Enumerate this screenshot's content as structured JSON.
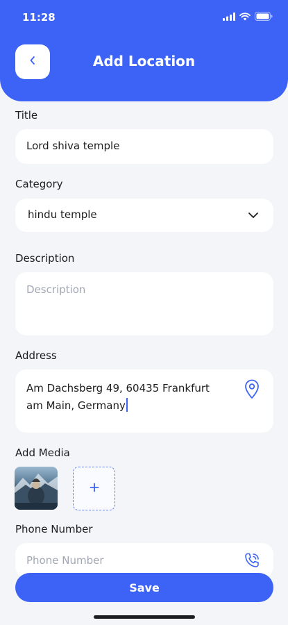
{
  "status_bar": {
    "time": "11:28"
  },
  "header": {
    "title": "Add Location",
    "back_icon": "chevron-left-icon"
  },
  "form": {
    "title": {
      "label": "Title",
      "value": "Lord shiva temple"
    },
    "category": {
      "label": "Category",
      "value": "hindu temple",
      "icon": "chevron-down-icon"
    },
    "description": {
      "label": "Description",
      "placeholder": "Description",
      "value": ""
    },
    "address": {
      "label": "Address",
      "value_line1": "Am Dachsberg 49, 60435 Frankfurt",
      "value_line2": "am Main, Germany",
      "icon": "location-pin-icon"
    },
    "media": {
      "label": "Add Media",
      "add_icon": "plus-icon"
    },
    "phone": {
      "label": "Phone Number",
      "placeholder": "Phone Number",
      "icon": "phone-icon"
    }
  },
  "save_button": {
    "label": "Save"
  },
  "colors": {
    "accent": "#3d63f6",
    "background": "#f4f5f9",
    "placeholder": "#a2a7b3"
  }
}
